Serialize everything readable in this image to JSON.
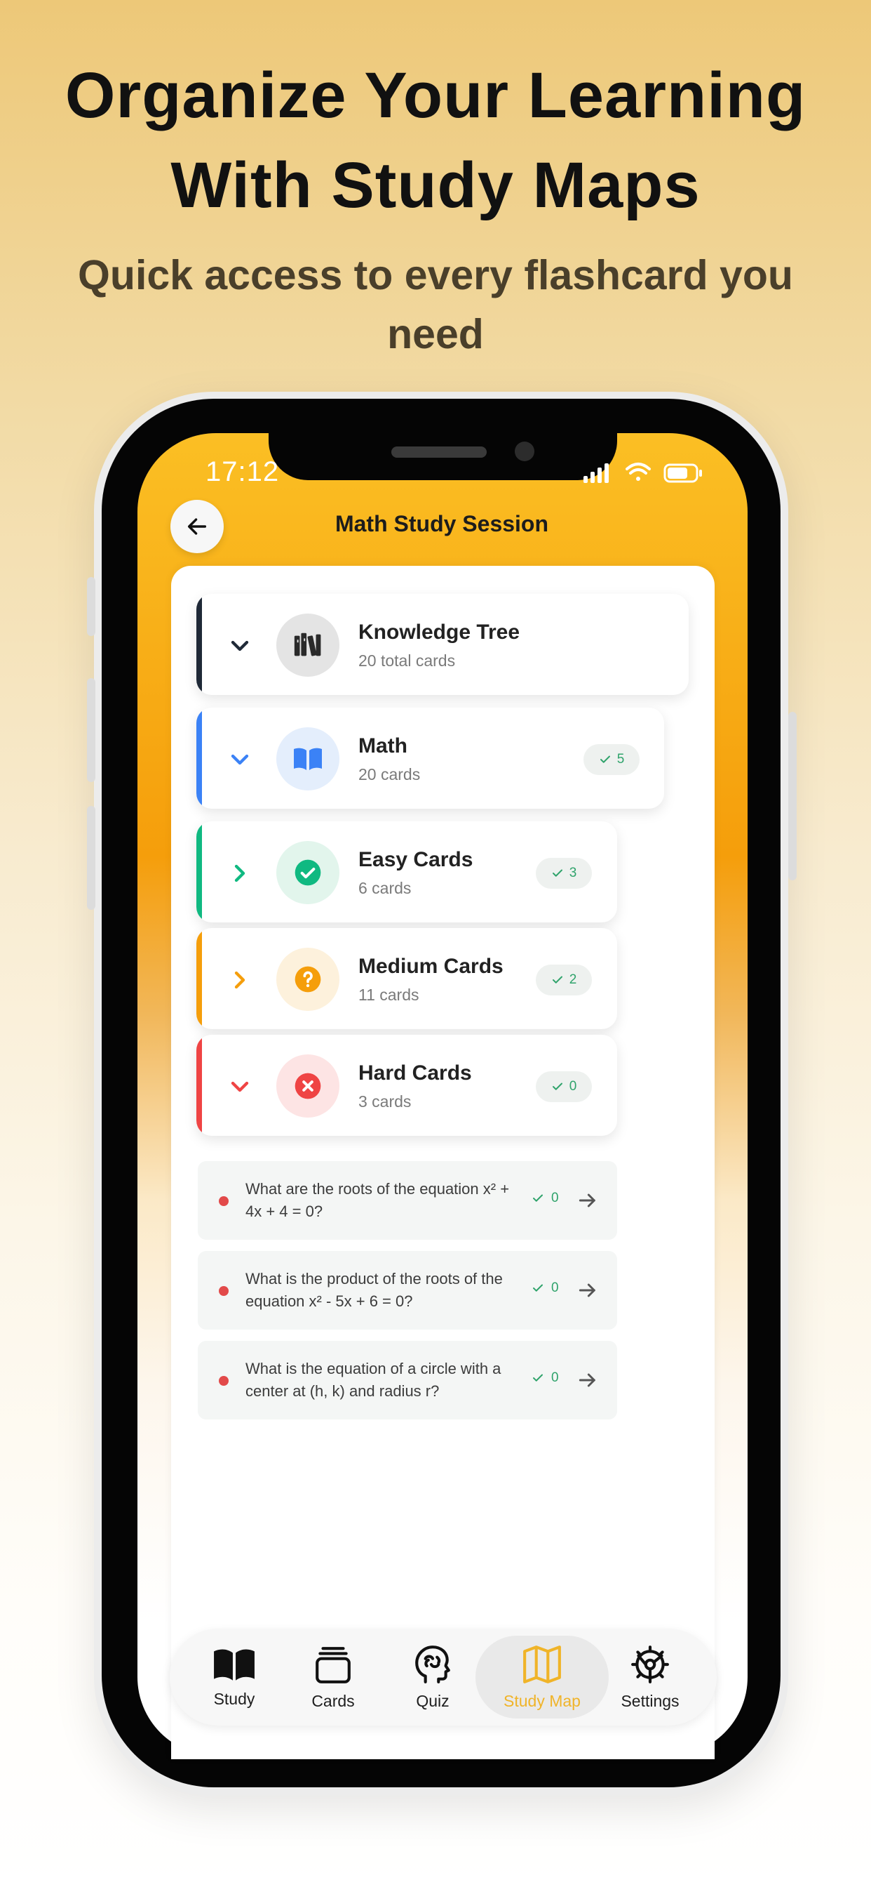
{
  "headline": "Organize Your Learning With Study Maps",
  "subheadline": "Quick access to every flashcard you need",
  "status_bar": {
    "time": "17:12"
  },
  "screen": {
    "title": "Math Study Session"
  },
  "tree": [
    {
      "title": "Knowledge Tree",
      "subtitle": "20 total cards",
      "badge": null,
      "color": "#1f2937",
      "icon": "books-icon",
      "expanded": true
    },
    {
      "title": "Math",
      "subtitle": "20 cards",
      "badge": "5",
      "color": "#3b82f6",
      "icon": "open-book-icon",
      "expanded": true
    },
    {
      "title": "Easy Cards",
      "subtitle": "6 cards",
      "badge": "3",
      "color": "#10b981",
      "icon": "check-circle-icon",
      "expanded": false
    },
    {
      "title": "Medium Cards",
      "subtitle": "11 cards",
      "badge": "2",
      "color": "#f59e0b",
      "icon": "question-circle-icon",
      "expanded": false
    },
    {
      "title": "Hard Cards",
      "subtitle": "3 cards",
      "badge": "0",
      "color": "#ef4444",
      "icon": "x-circle-icon",
      "expanded": true
    }
  ],
  "questions": [
    {
      "text": "What are the roots of the equation x² + 4x + 4 = 0?",
      "count": "0"
    },
    {
      "text": "What is the product of the roots of the equation x² - 5x + 6 = 0?",
      "count": "0"
    },
    {
      "text": "What is the equation of a circle with a center at (h, k) and radius r?",
      "count": "0"
    }
  ],
  "tabs": [
    {
      "label": "Study",
      "icon": "book-icon"
    },
    {
      "label": "Cards",
      "icon": "cards-icon"
    },
    {
      "label": "Quiz",
      "icon": "brain-icon"
    },
    {
      "label": "Study Map",
      "icon": "map-icon",
      "active": true
    },
    {
      "label": "Settings",
      "icon": "gear-icon"
    }
  ],
  "colors": {
    "accent": "#f0b429",
    "header_gradient": "#f59e0b",
    "success": "#2fa36b"
  }
}
